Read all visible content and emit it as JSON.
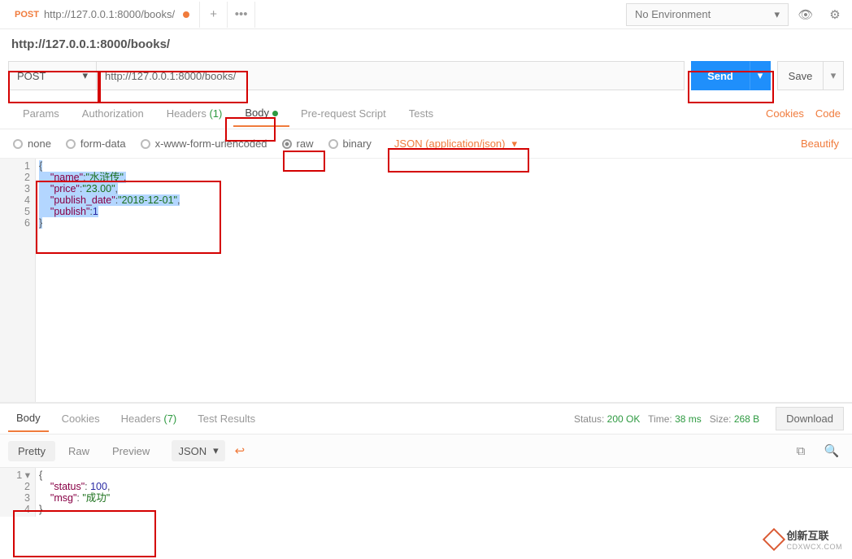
{
  "topbar": {
    "tab_method": "POST",
    "tab_title": "http://127.0.0.1:8000/books/",
    "plus": "+",
    "more": "•••",
    "env": "No Environment"
  },
  "header_url": "http://127.0.0.1:8000/books/",
  "request": {
    "method": "POST",
    "url": "http://127.0.0.1:8000/books/",
    "send": "Send",
    "save": "Save"
  },
  "tabs": {
    "params": "Params",
    "auth": "Authorization",
    "headers": "Headers",
    "headers_count": "(1)",
    "body": "Body",
    "pre": "Pre-request Script",
    "tests": "Tests",
    "cookies": "Cookies",
    "code": "Code"
  },
  "body_opts": {
    "none": "none",
    "formdata": "form-data",
    "xwww": "x-www-form-urlencoded",
    "raw": "raw",
    "binary": "binary",
    "content_type": "JSON (application/json)",
    "beautify": "Beautify"
  },
  "request_body": {
    "lines": [
      "1",
      "2",
      "3",
      "4",
      "5",
      "6"
    ],
    "json": {
      "name": "水浒传",
      "price": "23.00",
      "publish_date": "2018-12-01",
      "publish": 1
    }
  },
  "response": {
    "tabs": {
      "body": "Body",
      "cookies": "Cookies",
      "headers": "Headers",
      "headers_count": "(7)",
      "tests": "Test Results"
    },
    "status_label": "Status:",
    "status": "200 OK",
    "time_label": "Time:",
    "time": "38 ms",
    "size_label": "Size:",
    "size": "268 B",
    "download": "Download",
    "views": {
      "pretty": "Pretty",
      "raw": "Raw",
      "preview": "Preview",
      "format": "JSON"
    },
    "lines": [
      "1",
      "2",
      "3",
      "4"
    ],
    "json": {
      "status": 100,
      "msg": "成功"
    }
  },
  "watermark": {
    "txt1": "创新互联",
    "txt2": "CDXWCX.COM"
  }
}
